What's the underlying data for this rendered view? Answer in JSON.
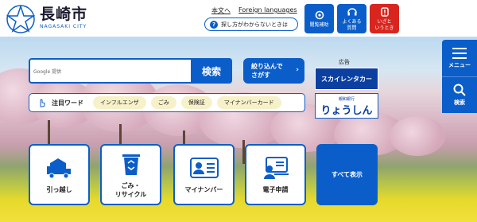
{
  "header": {
    "brand_name": "長崎市",
    "brand_sub": "NAGASAKI CITY",
    "link_main": "本文へ",
    "link_foreign": "Foreign languages",
    "help_text": "探し方がわからないときは",
    "help_icon": "?",
    "btn_reading": "閲覧補助",
    "btn_faq_1": "よくある",
    "btn_faq_2": "質問",
    "btn_emergency_1": "いざと",
    "btn_emergency_2": "いうとき"
  },
  "search": {
    "google_label": "Google 提供",
    "placeholder": "",
    "button": "検索",
    "narrow_1": "絞り込んで",
    "narrow_2": "さがす",
    "narrow_arrow": "›"
  },
  "attention": {
    "label": "注目ワード",
    "chips": [
      "インフルエンザ",
      "ごみ",
      "保険証",
      "マイナンバーカード"
    ]
  },
  "ads": {
    "label": "広告",
    "ad1": "スカイレンタカー",
    "ad2_small": "親和銀行",
    "ad2_big": "りょうしん"
  },
  "side": {
    "menu": "メニュー",
    "search": "検索"
  },
  "tiles": [
    {
      "label_1": "引っ越し",
      "label_2": ""
    },
    {
      "label_1": "ごみ・",
      "label_2": "リサイクル"
    },
    {
      "label_1": "マイナンバー",
      "label_2": ""
    },
    {
      "label_1": "電子申請",
      "label_2": ""
    }
  ],
  "tile_all": "すべて表示",
  "colors": {
    "primary": "#0b5ec9",
    "emergency": "#d8261f",
    "chip": "#f7f1c9"
  },
  "icons": {
    "logo": "nagasaki-star-logo",
    "reading": "gear-icon",
    "faq": "headset-icon",
    "emergency": "alert-icon",
    "menu": "hamburger-icon",
    "search": "search-icon",
    "moving": "truck-house-icon",
    "garbage": "recycle-bin-icon",
    "mynumber": "id-card-icon",
    "eapply": "computer-icon"
  }
}
